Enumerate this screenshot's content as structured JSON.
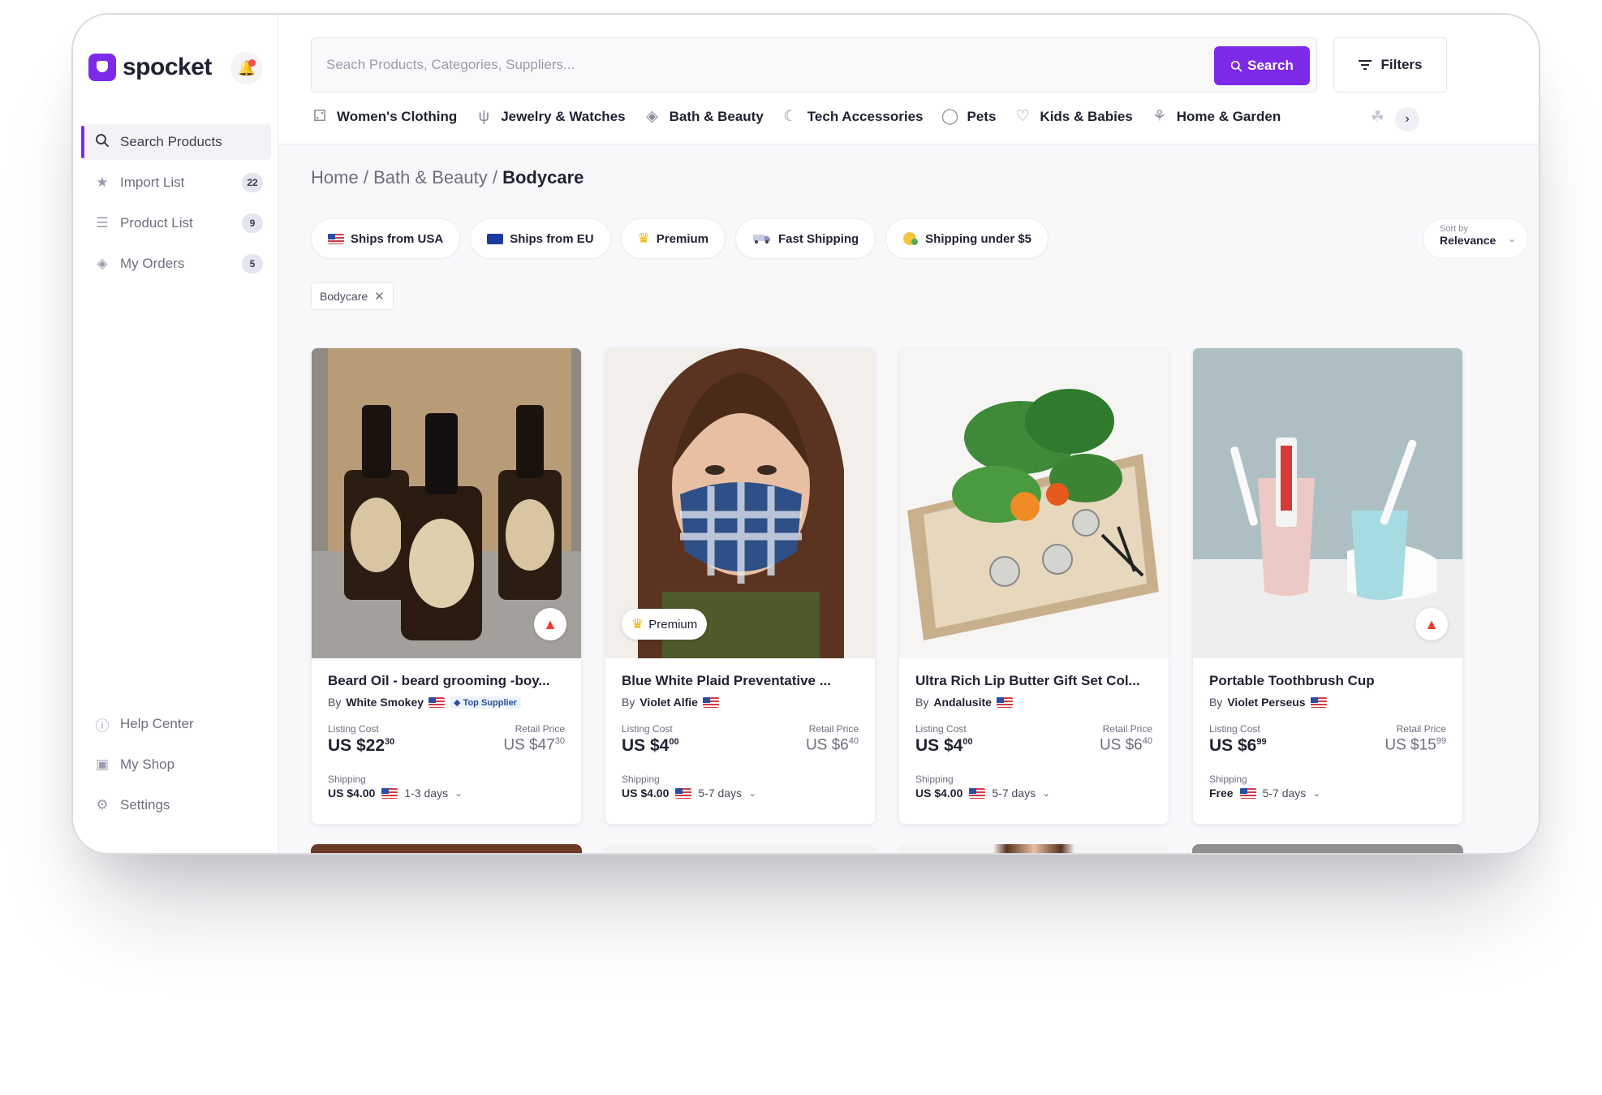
{
  "app": {
    "brand": "spocket"
  },
  "sidebar": {
    "items": [
      {
        "label": "Search Products",
        "icon": "search-icon",
        "badge": ""
      },
      {
        "label": "Import List",
        "icon": "star-icon",
        "badge": "22"
      },
      {
        "label": "Product List",
        "icon": "list-icon",
        "badge": "9"
      },
      {
        "label": "My Orders",
        "icon": "orders-icon",
        "badge": "5"
      }
    ],
    "bottom": [
      {
        "label": "Help Center",
        "icon": "help-icon"
      },
      {
        "label": "My Shop",
        "icon": "shop-icon"
      },
      {
        "label": "Settings",
        "icon": "gear-icon"
      }
    ]
  },
  "search": {
    "placeholder": "Seach Products, Categories, Suppliers...",
    "button_label": "Search",
    "filters_label": "Filters"
  },
  "categories": [
    {
      "label": "Women's Clothing",
      "icon": "dress-icon"
    },
    {
      "label": "Jewelry & Watches",
      "icon": "necklace-icon"
    },
    {
      "label": "Bath & Beauty",
      "icon": "bottle-icon"
    },
    {
      "label": "Tech Accessories",
      "icon": "headphones-icon"
    },
    {
      "label": "Pets",
      "icon": "pet-bowl-icon"
    },
    {
      "label": "Kids & Babies",
      "icon": "onesie-icon"
    },
    {
      "label": "Home & Garden",
      "icon": "plant-icon"
    }
  ],
  "breadcrumb": {
    "home": "Home",
    "sep": "/",
    "parent": "Bath & Beauty",
    "current": "Bodycare"
  },
  "chips": [
    {
      "label": "Ships from USA",
      "icon": "flag-us-icon"
    },
    {
      "label": "Ships from EU",
      "icon": "flag-eu-icon"
    },
    {
      "label": "Premium",
      "icon": "crown-icon"
    },
    {
      "label": "Fast Shipping",
      "icon": "truck-icon"
    },
    {
      "label": "Shipping under $5",
      "icon": "coin-icon"
    }
  ],
  "sort": {
    "label": "Sort by",
    "value": "Relevance"
  },
  "active_tag": {
    "label": "Bodycare"
  },
  "labels": {
    "by": "By",
    "listing_cost": "Listing Cost",
    "retail_price": "Retail Price",
    "shipping": "Shipping",
    "top_supplier": "Top Supplier",
    "premium": "Premium"
  },
  "products": [
    {
      "title": "Beard Oil - beard grooming -boy...",
      "supplier": "White Smokey",
      "top_supplier": true,
      "listing_main": "US $22",
      "listing_cents": "30",
      "retail_main": "US $47",
      "retail_cents": "30",
      "shipping_price": "US $4.00",
      "shipping_days": "1-3 days",
      "badge": "fire"
    },
    {
      "title": "Blue White Plaid Preventative ...",
      "supplier": "Violet Alfie",
      "top_supplier": false,
      "listing_main": "US $4",
      "listing_cents": "00",
      "retail_main": "US $6",
      "retail_cents": "40",
      "shipping_price": "US $4.00",
      "shipping_days": "5-7 days",
      "badge": "premium"
    },
    {
      "title": "Ultra Rich Lip Butter Gift Set Col...",
      "supplier": "Andalusite",
      "top_supplier": false,
      "listing_main": "US $4",
      "listing_cents": "00",
      "retail_main": "US $6",
      "retail_cents": "40",
      "shipping_price": "US $4.00",
      "shipping_days": "5-7 days",
      "badge": ""
    },
    {
      "title": "Portable Toothbrush Cup",
      "supplier": "Violet Perseus",
      "top_supplier": false,
      "listing_main": "US $6",
      "listing_cents": "99",
      "retail_main": "US $15",
      "retail_cents": "99",
      "shipping_price": "Free",
      "shipping_days": "5-7 days",
      "badge": "fire"
    }
  ],
  "colors": {
    "accent": "#7d2ae8",
    "text": "#1f2233",
    "muted": "#6d6f7e"
  }
}
